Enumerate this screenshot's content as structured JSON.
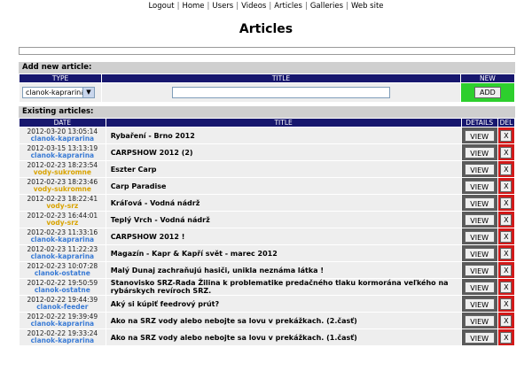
{
  "nav": [
    "Logout",
    "Home",
    "Users",
    "Videos",
    "Articles",
    "Galleries",
    "Web site"
  ],
  "page_title": "Articles",
  "add_section": {
    "heading": "Add new article:",
    "col_type": "TYPE",
    "col_title": "TITLE",
    "col_new": "NEW",
    "type_selected": "clanok-kaprarina",
    "title_value": "",
    "add_label": "ADD"
  },
  "existing_section": {
    "heading": "Existing articles:",
    "col_date": "DATE",
    "col_title": "TITLE",
    "col_details": "DETAILS",
    "col_del": "DEL",
    "view_label": "VIEW",
    "del_label": "X"
  },
  "articles": [
    {
      "date": "2012-03-20 13:05:14",
      "type": "clanok-kaprarina",
      "title": "Rybaření - Brno 2012"
    },
    {
      "date": "2012-03-15 13:13:19",
      "type": "clanok-kaprarina",
      "title": "CARPSHOW 2012 (2)"
    },
    {
      "date": "2012-02-23 18:23:54",
      "type": "vody-sukromne",
      "title": "Eszter Carp"
    },
    {
      "date": "2012-02-23 18:23:46",
      "type": "vody-sukromne",
      "title": "Carp Paradise"
    },
    {
      "date": "2012-02-23 18:22:41",
      "type": "vody-srz",
      "title": "Kráľová - Vodná nádrž"
    },
    {
      "date": "2012-02-23 16:44:01",
      "type": "vody-srz",
      "title": "Teplý Vrch - Vodná nádrž"
    },
    {
      "date": "2012-02-23 11:33:16",
      "type": "clanok-kaprarina",
      "title": "CARPSHOW 2012 !"
    },
    {
      "date": "2012-02-23 11:22:23",
      "type": "clanok-kaprarina",
      "title": "Magazín - Kapr & Kapří svět - marec 2012"
    },
    {
      "date": "2012-02-23 10:07:28",
      "type": "clanok-ostatne",
      "title": "Malý Dunaj zachraňujú hasiči, unikla neznáma látka !"
    },
    {
      "date": "2012-02-22 19:50:59",
      "type": "clanok-ostatne",
      "title": "Stanovisko SRZ-Rada Žilina k problematike predačného tlaku kormorána veľkého na rybárskych revíroch SRZ."
    },
    {
      "date": "2012-02-22 19:44:39",
      "type": "clanok-feeder",
      "title": "Aký si kúpiť feedrový prút?"
    },
    {
      "date": "2012-02-22 19:39:49",
      "type": "clanok-kaprarina",
      "title": "Ako na SRZ vody alebo nebojte sa lovu v prekážkach. (2.časť)"
    },
    {
      "date": "2012-02-22 19:33:24",
      "type": "clanok-kaprarina",
      "title": "Ako na SRZ vody alebo nebojte sa lovu v prekážkach. (1.časť)"
    }
  ]
}
